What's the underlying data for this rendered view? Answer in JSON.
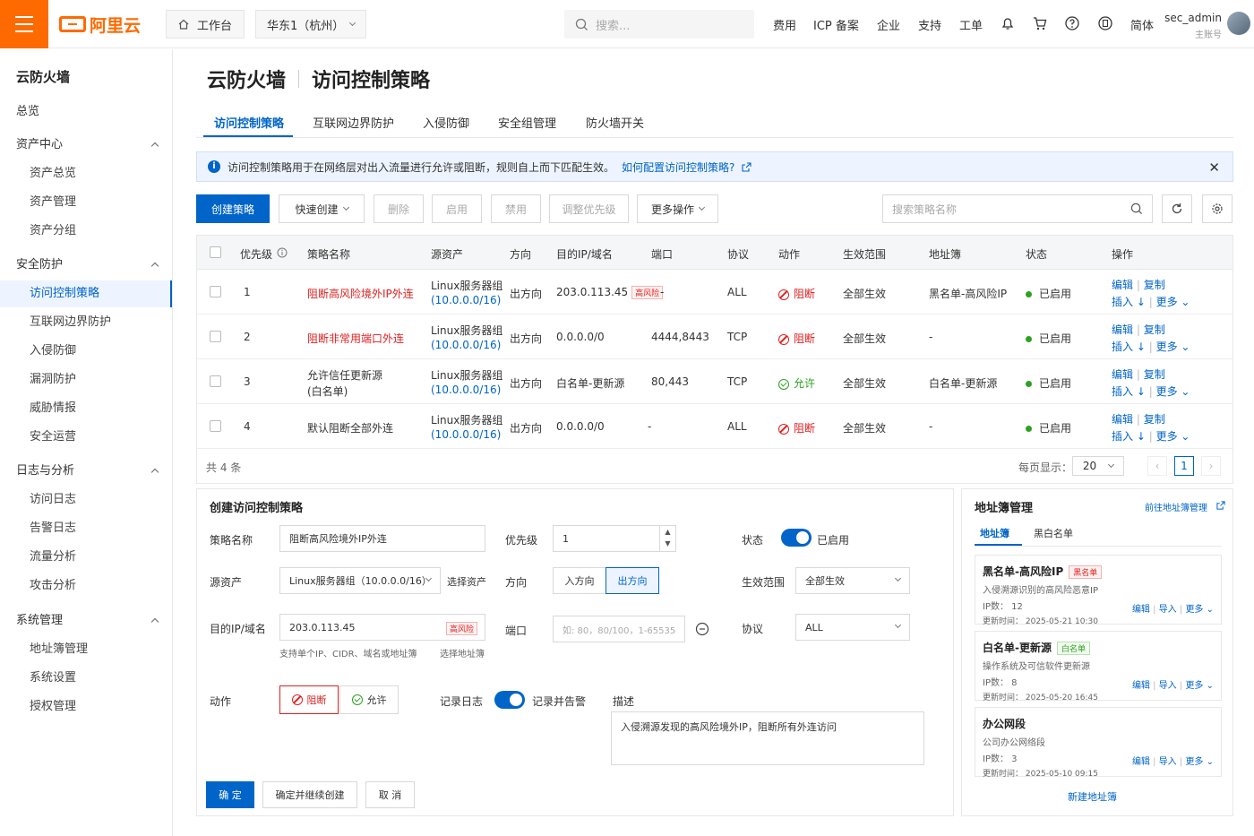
{
  "topbar": {
    "logo": "阿里云",
    "workbench": "工作台",
    "region": "华东1（杭州）",
    "search_placeholder": "搜索...",
    "links": [
      "费用",
      "ICP 备案",
      "企业",
      "支持",
      "工单"
    ],
    "lang": "简体",
    "user_name": "sec_admin",
    "user_role": "主账号"
  },
  "sidebar": {
    "title": "云防火墙",
    "overview": "总览",
    "groups": [
      {
        "label": "资产中心",
        "items": [
          "资产总览",
          "资产管理",
          "资产分组"
        ]
      },
      {
        "label": "安全防护",
        "items": [
          "访问控制策略",
          "互联网边界防护",
          "入侵防御",
          "漏洞防护",
          "威胁情报",
          "安全运营"
        ]
      },
      {
        "label": "日志与分析",
        "items": [
          "访问日志",
          "告警日志",
          "流量分析",
          "攻击分析"
        ]
      },
      {
        "label": "系统管理",
        "items": [
          "地址簿管理",
          "系统设置",
          "授权管理"
        ]
      }
    ]
  },
  "page": {
    "title_main": "云防火墙",
    "title_sub": "访问控制策略",
    "tabs": [
      "访问控制策略",
      "互联网边界防护",
      "入侵防御",
      "安全组管理",
      "防火墙开关"
    ],
    "info_text": "访问控制策略用于在网络层对出入流量进行允许或阻断，规则自上而下匹配生效。",
    "info_link": "如何配置访问控制策略?"
  },
  "toolbar": {
    "create": "创建策略",
    "quick_create": "快速创建",
    "delete": "删除",
    "enable": "启用",
    "disable": "禁用",
    "adjust_priority": "调整优先级",
    "more": "更多操作",
    "search_placeholder": "搜索策略名称"
  },
  "table": {
    "headers": [
      "优先级",
      "策略名称",
      "源资产",
      "方向",
      "目的IP/域名",
      "端口",
      "协议",
      "动作",
      "生效范围",
      "地址簿",
      "状态",
      "操作"
    ],
    "rows": [
      {
        "priority": "1",
        "name": "阻断高风险境外IP外连",
        "name_color": "#e02020",
        "src": "Linux服务器组",
        "src_cidr": "(10.0.0.0/16)",
        "dir": "出方向",
        "dst": "203.0.113.45",
        "dst_tag": "高风险",
        "port": "-",
        "proto": "ALL",
        "action": "阻断",
        "scope": "全部生效",
        "book": "黑名单-高风险IP",
        "status": "已启用"
      },
      {
        "priority": "2",
        "name": "阻断非常用端口外连",
        "name_color": "#e02020",
        "src": "Linux服务器组",
        "src_cidr": "(10.0.0.0/16)",
        "dir": "出方向",
        "dst": "0.0.0.0/0",
        "dst_tag": "",
        "port": "4444,8443",
        "proto": "TCP",
        "action": "阻断",
        "scope": "全部生效",
        "book": "-",
        "status": "已启用"
      },
      {
        "priority": "3",
        "name": "允许信任更新源",
        "name2": "(白名单)",
        "name_color": "#333333",
        "src": "Linux服务器组",
        "src_cidr": "(10.0.0.0/16)",
        "dir": "出方向",
        "dst": "白名单-更新源",
        "dst_tag": "",
        "port": "80,443",
        "proto": "TCP",
        "action": "允许",
        "scope": "全部生效",
        "book": "白名单-更新源",
        "status": "已启用"
      },
      {
        "priority": "4",
        "name": "默认阻断全部外连",
        "name_color": "#333333",
        "src": "Linux服务器组",
        "src_cidr": "(10.0.0.0/16)",
        "dir": "出方向",
        "dst": "0.0.0.0/0",
        "dst_tag": "",
        "port": "-",
        "proto": "ALL",
        "action": "阻断",
        "scope": "全部生效",
        "book": "-",
        "status": "已启用"
      }
    ],
    "ops": {
      "edit": "编辑",
      "copy": "复制",
      "insert": "插入 ↓",
      "more": "更多"
    },
    "total": "共 4 条",
    "page_size_label": "每页显示：",
    "page_size": "20",
    "current_page": "1"
  },
  "form": {
    "title": "创建访问控制策略",
    "name_label": "策略名称",
    "name_value": "阻断高风险境外IP外连",
    "priority_label": "优先级",
    "priority_value": "1",
    "status_label": "状态",
    "status_value": "已启用",
    "src_label": "源资产",
    "src_value": "Linux服务器组（10.0.0.0/16）",
    "src_link": "选择资产",
    "dir_label": "方向",
    "dir_in": "入方向",
    "dir_out": "出方向",
    "scope_label": "生效范围",
    "scope_value": "全部生效",
    "dst_label": "目的IP/域名",
    "dst_value": "203.0.113.45",
    "dst_tag": "高风险",
    "dst_hint": "支持单个IP、CIDR、域名或地址簿",
    "dst_link": "选择地址簿",
    "port_label": "端口",
    "port_placeholder": "如: 80，80/100，1-65535",
    "proto_label": "协议",
    "proto_value": "ALL",
    "action_label": "动作",
    "action_deny": "阻断",
    "action_allow": "允许",
    "log_label": "记录日志",
    "log_value": "记录并告警",
    "desc_label": "描述",
    "desc_value": "入侵溯源发现的高风险境外IP，阻断所有外连访问",
    "ok": "确 定",
    "ok_continue": "确定并继续创建",
    "cancel": "取 消"
  },
  "addressbook": {
    "title": "地址簿管理",
    "goto": "前往地址簿管理",
    "tabs": [
      "地址簿",
      "黑白名单"
    ],
    "cards": [
      {
        "name": "黑名单-高风险IP",
        "tag": "黑名单",
        "desc": "入侵溯源识别的高风险恶意IP",
        "count": "IP数：  12",
        "time": "更新时间：  2025-05-21 10:30"
      },
      {
        "name": "白名单-更新源",
        "tag": "白名单",
        "desc": "操作系统及可信软件更新源",
        "count": "IP数：  8",
        "time": "更新时间：  2025-05-20 16:45"
      },
      {
        "name": "办公网段",
        "tag": "",
        "desc": "公司办公网络段",
        "count": "IP数：  3",
        "time": "更新时间：  2025-05-10 09:15"
      }
    ],
    "card_ops": {
      "edit": "编辑",
      "import": "导入",
      "more": "更多"
    },
    "new_book": "新建地址簿"
  }
}
